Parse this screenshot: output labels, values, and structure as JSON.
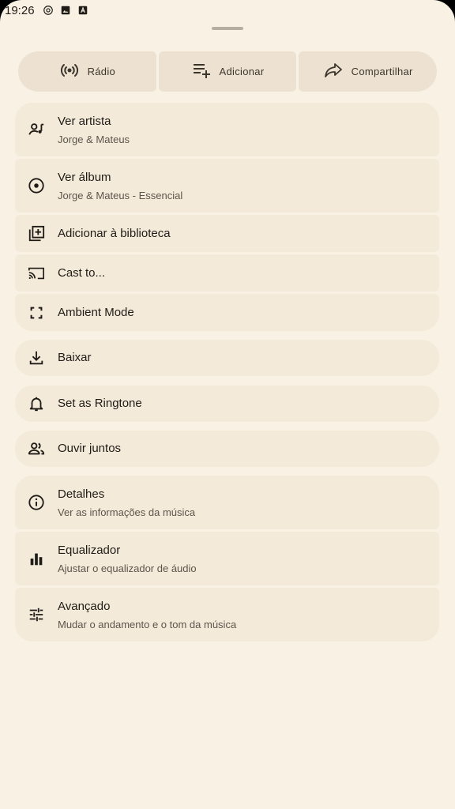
{
  "status_bar": {
    "time": "19:26",
    "icons": [
      "at-sign-icon",
      "image-icon",
      "text-a-icon"
    ]
  },
  "actions": [
    {
      "label": "Rádio",
      "icon": "radio-broadcast-icon"
    },
    {
      "label": "Adicionar",
      "icon": "playlist-add-icon"
    },
    {
      "label": "Compartilhar",
      "icon": "share-icon"
    }
  ],
  "menu": {
    "view_artist": {
      "title": "Ver artista",
      "subtitle": "Jorge & Mateus",
      "icon": "artist-icon"
    },
    "view_album": {
      "title": "Ver álbum",
      "subtitle": "Jorge & Mateus - Essencial",
      "icon": "album-icon"
    },
    "add_library": {
      "title": "Adicionar à biblioteca",
      "icon": "library-add-icon"
    },
    "cast": {
      "title": "Cast to...",
      "icon": "cast-icon"
    },
    "ambient": {
      "title": "Ambient Mode",
      "icon": "fullscreen-icon"
    },
    "download": {
      "title": "Baixar",
      "icon": "download-icon"
    },
    "ringtone": {
      "title": "Set as Ringtone",
      "icon": "bell-icon"
    },
    "listen_together": {
      "title": "Ouvir juntos",
      "icon": "people-icon"
    },
    "details": {
      "title": "Detalhes",
      "subtitle": "Ver as informações da música",
      "icon": "info-icon"
    },
    "equalizer": {
      "title": "Equalizador",
      "subtitle": "Ajustar o equalizador de áudio",
      "icon": "equalizer-icon"
    },
    "advanced": {
      "title": "Avançado",
      "subtitle": "Mudar o andamento e o tom da música",
      "icon": "tune-icon"
    }
  },
  "colors": {
    "sheet_background": "#f9f1e3",
    "item_background": "#f4ead9",
    "action_background": "#ede2d1",
    "text_primary": "#1f1b16",
    "text_secondary": "#5c554b"
  }
}
